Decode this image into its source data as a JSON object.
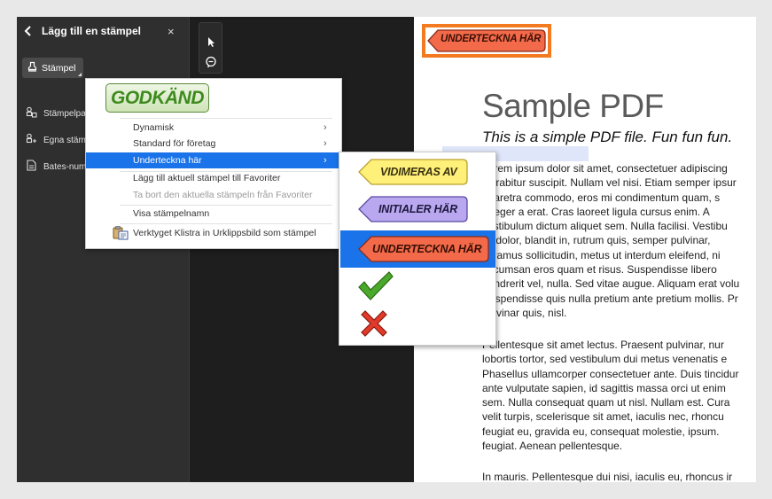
{
  "panel": {
    "title": "Lägg till en stämpel",
    "close_symbol": "×",
    "stamp_button_label": "Stämpel",
    "items": [
      {
        "label": "Stämpelpal",
        "icon": "stamp-palette-icon"
      },
      {
        "label": "Egna stämp",
        "icon": "custom-stamp-icon"
      },
      {
        "label": "Bates-numr",
        "icon": "bates-number-icon"
      }
    ]
  },
  "tools": [
    "select-arrow-icon",
    "comment-icon"
  ],
  "menu": {
    "header_stamp": "GODKÄND",
    "items": [
      {
        "label": "Dynamisk",
        "submenu": true
      },
      {
        "label": "Standard för företag",
        "submenu": true
      },
      {
        "label": "Underteckna här",
        "submenu": true,
        "highlighted": true
      },
      {
        "label": "Lägg till aktuell stämpel till Favoriter"
      },
      {
        "label": "Ta bort den aktuella stämpeln från Favoriter",
        "disabled": true
      },
      {
        "label": "Visa stämpelnamn"
      },
      {
        "label": "Verktyget Klistra in Urklippsbild som stämpel",
        "icon": "paste-clipboard-icon"
      }
    ],
    "arrow_symbol": "›"
  },
  "submenu": {
    "stamps": [
      {
        "label": "VIDIMERAS AV",
        "color": "#fff07a",
        "border": "#b9a12a"
      },
      {
        "label": "INITIALER HÄR",
        "color": "#b9a8f0",
        "border": "#5a4aa0"
      },
      {
        "label": "UNDERTECKNA HÄR",
        "color": "#f26a4a",
        "border": "#8a2a1a",
        "selected": true
      }
    ],
    "icons": [
      "checkmark-icon",
      "x-mark-icon"
    ]
  },
  "document": {
    "placed_stamp": "UNDERTECKNA HÄR",
    "title": "Sample PDF",
    "subtitle": "This is a simple PDF file. Fun fun fun.",
    "para1": [
      "Lorem ipsum dolor sit amet, consectetuer adipiscing",
      "Curabitur suscipit. Nullam vel nisi. Etiam semper ipsur",
      "pharetra commodo, eros mi condimentum quam, s",
      "Integer a erat. Cras laoreet ligula cursus enim. A",
      "vestibulum dictum aliquet sem. Nulla facilisi. Vestibu",
      "sit dolor, blandit in, rutrum quis, semper pulvinar,",
      "Vivamus sollicitudin, metus ut interdum eleifend, ni",
      "accumsan eros quam et risus. Suspendisse libero",
      "hendrerit vel, nulla. Sed vitae augue. Aliquam erat volu",
      "Suspendisse quis nulla pretium ante pretium mollis. Pr",
      "pulvinar quis, nisl."
    ],
    "para2": [
      "Pellentesque sit amet lectus. Praesent pulvinar, nur",
      "lobortis tortor, sed vestibulum dui metus venenatis e",
      "Phasellus ullamcorper consectetuer ante. Duis tincidur",
      "ante vulputate sapien, id sagittis massa orci ut enim",
      "sem. Nulla consequat quam ut nisl. Nullam est. Cura",
      "velit turpis, scelerisque sit amet, iaculis nec, rhoncu",
      "feugiat eu, gravida eu, consequat molestie, ipsum.",
      "feugiat. Aenean pellentesque."
    ],
    "para3": [
      "In mauris. Pellentesque dui nisi, iaculis eu, rhoncus ir"
    ]
  },
  "colors": {
    "accent": "#1a73e8",
    "stamp_frame": "#f47a20",
    "approved_green": "#3e8a1e"
  }
}
